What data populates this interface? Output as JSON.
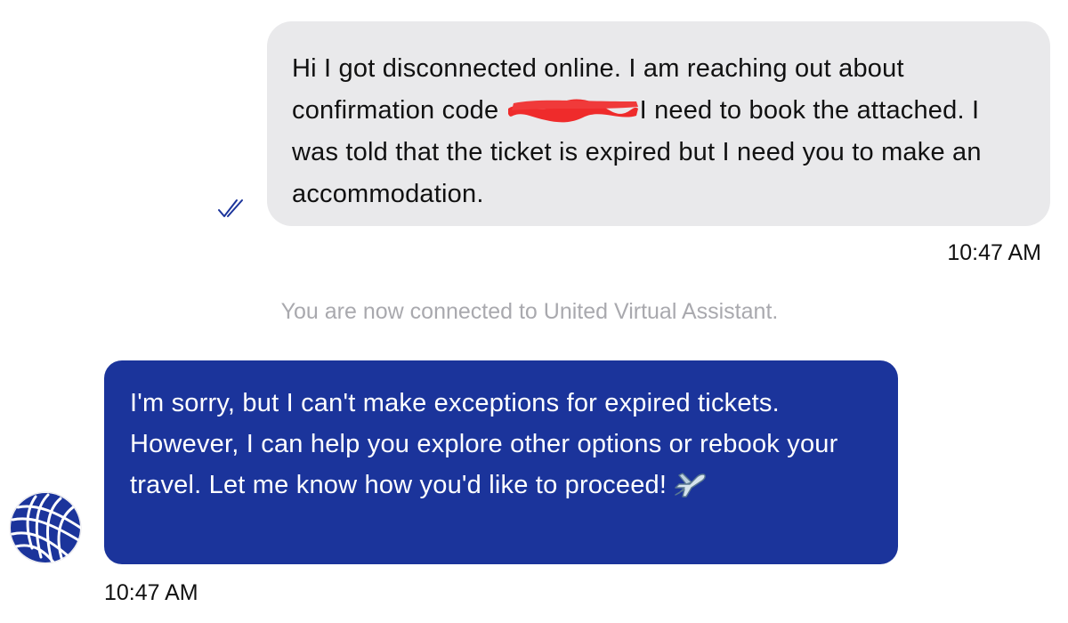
{
  "outgoing_message": {
    "text_before_redaction": "Hi I got disconnected online. I am reaching out about confirmation code ",
    "text_after_redaction": "I need to book the attached. I was told that the ticket is expired but I need you to make an accommodation.",
    "timestamp": "10:47 AM",
    "bubble_color": "#e9e9eb",
    "read_receipt_color": "#1b349b"
  },
  "system_notice": {
    "text": "You are now connected to United Virtual Assistant."
  },
  "incoming_message": {
    "text": "I'm sorry, but I can't make exceptions for expired tickets. However, I can help you explore other options or rebook your travel. Let me know how you'd like to proceed!",
    "emoji_icon": "airplane-icon",
    "timestamp": "10:47 AM",
    "bubble_color": "#1b349b",
    "sender_avatar_icon": "united-globe-logo-icon"
  }
}
